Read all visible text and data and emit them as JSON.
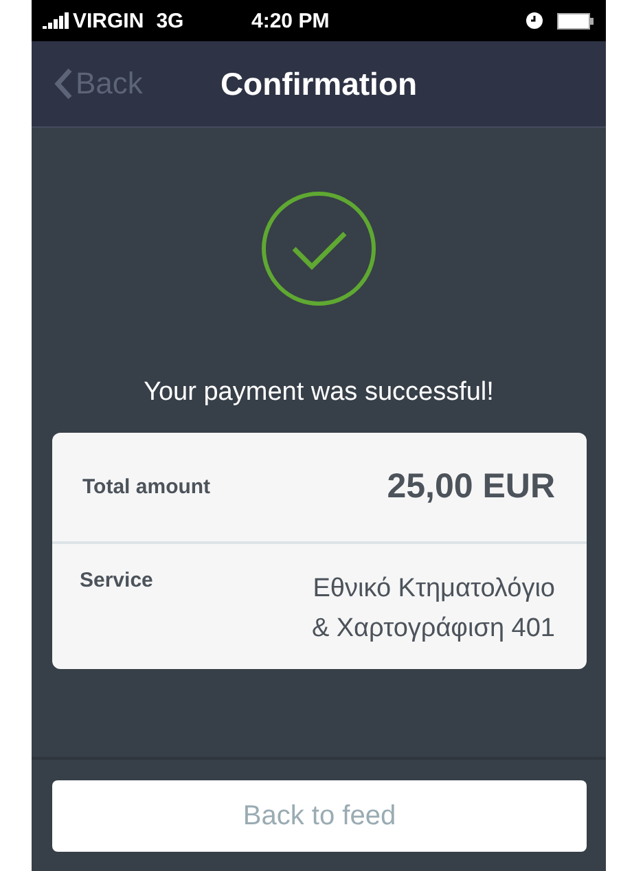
{
  "status_bar": {
    "carrier": "VIRGIN",
    "network": "3G",
    "time": "4:20 PM"
  },
  "nav_bar": {
    "back": {
      "label": "Back",
      "disabled": true
    },
    "title": "Confirmation"
  },
  "message": "Your payment was successful!",
  "details": [
    {
      "kind": "amount",
      "label": "Total amount",
      "value": "25,00 EUR"
    },
    {
      "kind": "text",
      "label": "Service",
      "value": "Εθνικό Κτηματολόγιο\n& Χαρτογράφιση 401"
    }
  ],
  "button": "Back to feed"
}
